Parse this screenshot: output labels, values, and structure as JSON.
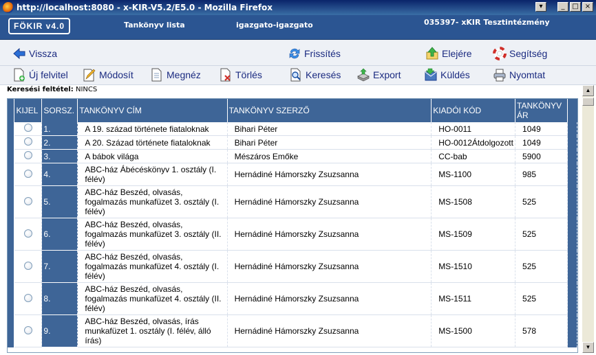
{
  "window": {
    "title": "http://localhost:8080 - x-KIR-V5.2/E5.0 - Mozilla Firefox",
    "controls": [
      "_",
      "□",
      "×"
    ]
  },
  "header": {
    "logo": "FÖKIR v4.0",
    "page_name": "Tankönyv lista",
    "user": "igazgato-igazgato",
    "institution": "035397- xKIR Tesztintézmény"
  },
  "toolbar_top": {
    "back": "Vissza",
    "refresh": "Frissítés",
    "home": "Elejére",
    "help": "Segítség"
  },
  "toolbar_actions": {
    "new": "Új felvitel",
    "edit": "Módosít",
    "view": "Megnéz",
    "delete": "Törlés",
    "search": "Keresés",
    "export": "Export",
    "send": "Küldés",
    "print": "Nyomtat"
  },
  "filter": {
    "label": "Keresési feltétel:",
    "value": "NINCS"
  },
  "table": {
    "headers": {
      "select": "KIJEL",
      "index": "SORSZ.",
      "title": "TANKÖNYV CÍM",
      "author": "TANKÖNYV SZERZŐ",
      "code": "KIADÓI KÓD",
      "price": "TANKÖNYV ÁR"
    },
    "rows": [
      {
        "index": "1.",
        "title": "A 19. század története fiataloknak",
        "author": "Bihari Péter",
        "code": "HO-0011",
        "price": "1049"
      },
      {
        "index": "2.",
        "title": "A 20. Század története fiataloknak",
        "author": "Bihari Péter",
        "code": "HO-0012Átdolgozott",
        "price": "1049"
      },
      {
        "index": "3.",
        "title": "A bábok világa",
        "author": "Mészáros Emőke",
        "code": "CC-bab",
        "price": "5900"
      },
      {
        "index": "4.",
        "title": "ABC-ház Ábécéskönyv 1. osztály (I. félév)",
        "author": "Hernádiné Hámorszky Zsuzsanna",
        "code": "MS-1100",
        "price": "985"
      },
      {
        "index": "5.",
        "title": "ABC-ház Beszéd, olvasás, fogalmazás munkafüzet 3. osztály (I. félév)",
        "author": "Hernádiné Hámorszky Zsuzsanna",
        "code": "MS-1508",
        "price": "525"
      },
      {
        "index": "6.",
        "title": "ABC-ház Beszéd, olvasás, fogalmazás munkafüzet 3. osztály (II. félév)",
        "author": "Hernádiné Hámorszky Zsuzsanna",
        "code": "MS-1509",
        "price": "525"
      },
      {
        "index": "7.",
        "title": "ABC-ház Beszéd, olvasás, fogalmazás munkafüzet 4. osztály (I. félév)",
        "author": "Hernádiné Hámorszky Zsuzsanna",
        "code": "MS-1510",
        "price": "525"
      },
      {
        "index": "8.",
        "title": "ABC-ház Beszéd, olvasás, fogalmazás munkafüzet 4. osztály (II. félév)",
        "author": "Hernádiné Hámorszky Zsuzsanna",
        "code": "MS-1511",
        "price": "525"
      },
      {
        "index": "9.",
        "title": "ABC-ház Beszéd, olvasás, írás munkafüzet 1. osztály (I. félév, álló írás)",
        "author": "Hernádiné Hámorszky Zsuzsanna",
        "code": "MS-1500",
        "price": "578"
      }
    ]
  },
  "colors": {
    "header_bg": "#2b5592",
    "table_header_bg": "#3e6597",
    "toolbar_bg": "#eef1f6",
    "link_text": "#1a2a80"
  }
}
